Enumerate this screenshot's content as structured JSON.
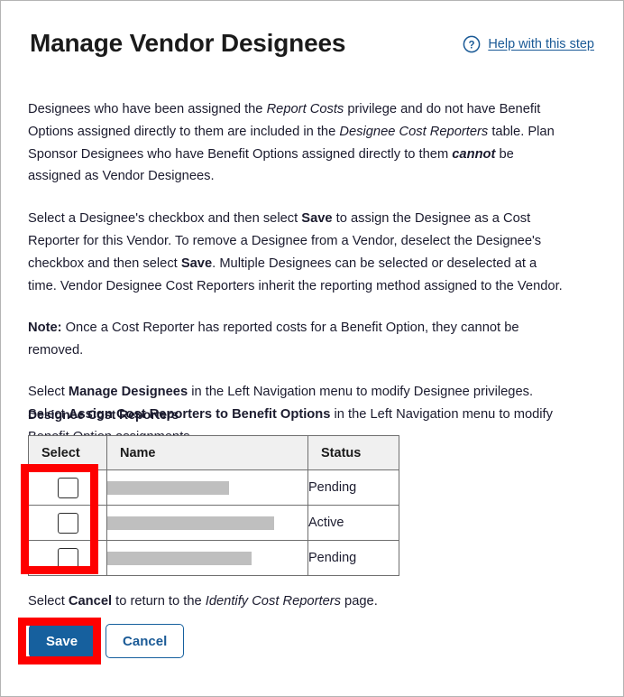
{
  "header": {
    "title": "Manage Vendor Designees",
    "help_icon": "question-circle-icon",
    "help_link": "Help with this step"
  },
  "paragraphs": [
    {
      "id": "p1",
      "runs": [
        {
          "text": "Designees who have been assigned the ",
          "style": "normal"
        },
        {
          "text": "Report Costs",
          "style": "italic"
        },
        {
          "text": " privilege and do not have Benefit Options assigned directly to them are included in the ",
          "style": "normal"
        },
        {
          "text": "Designee Cost Reporters",
          "style": "italic"
        },
        {
          "text": " table. Plan Sponsor Designees who have Benefit Options assigned directly to them ",
          "style": "normal"
        },
        {
          "text": "cannot",
          "style": "bold-italic"
        },
        {
          "text": " be assigned as Vendor Designees.",
          "style": "normal"
        }
      ]
    },
    {
      "id": "p2",
      "runs": [
        {
          "text": "Select a Designee's checkbox and then select ",
          "style": "normal"
        },
        {
          "text": "Save",
          "style": "bold"
        },
        {
          "text": " to assign the Designee as a Cost Reporter for this Vendor. To remove a Designee from a Vendor, deselect the Designee's checkbox and then select ",
          "style": "normal"
        },
        {
          "text": "Save",
          "style": "bold"
        },
        {
          "text": ". Multiple Designees can be selected or deselected at a time. Vendor Designee Cost Reporters inherit the reporting method assigned to the Vendor.",
          "style": "normal"
        }
      ]
    },
    {
      "id": "p3",
      "runs": [
        {
          "text": "Note:",
          "style": "bold"
        },
        {
          "text": " Once a Cost Reporter has reported costs for a Benefit Option, they cannot be removed.",
          "style": "normal"
        }
      ]
    },
    {
      "id": "p4",
      "runs": [
        {
          "text": "Select ",
          "style": "normal"
        },
        {
          "text": "Manage Designees",
          "style": "bold"
        },
        {
          "text": " in the Left Navigation menu to modify Designee privileges. Select ",
          "style": "normal"
        },
        {
          "text": "Assign Cost Reporters to Benefit Options",
          "style": "bold"
        },
        {
          "text": " in the Left Navigation menu to modify Benefit Option assignments.",
          "style": "normal"
        }
      ]
    }
  ],
  "table": {
    "label": "Designee Cost Reporters",
    "columns": [
      "Select",
      "Name",
      "Status"
    ],
    "rows": [
      {
        "selected": false,
        "name": "",
        "name_redacted_width": 135,
        "status": "Pending"
      },
      {
        "selected": false,
        "name": "",
        "name_redacted_width": 185,
        "status": "Active"
      },
      {
        "selected": false,
        "name": "",
        "name_redacted_width": 160,
        "status": "Pending"
      }
    ]
  },
  "footer": {
    "note_runs": [
      {
        "text": "Select ",
        "style": "normal"
      },
      {
        "text": "Cancel",
        "style": "bold"
      },
      {
        "text": " to return to the ",
        "style": "normal"
      },
      {
        "text": "Identify Cost Reporters",
        "style": "italic"
      },
      {
        "text": " page.",
        "style": "normal"
      }
    ],
    "save_label": "Save",
    "cancel_label": "Cancel"
  },
  "annotations": [
    {
      "id": "anno-checkbox-col",
      "target": "checkbox-column",
      "color": "#fe0000"
    },
    {
      "id": "anno-save-button",
      "target": "save-button",
      "color": "#fe0000"
    }
  ],
  "colors": {
    "primary_blue": "#16609e",
    "link_blue": "#1a5a96",
    "text": "#1b1b2e",
    "header_bg": "#f0f0f0",
    "redact_gray": "#bfbfbf",
    "annotation_red": "#fe0000",
    "border": "#6f6f6f"
  }
}
